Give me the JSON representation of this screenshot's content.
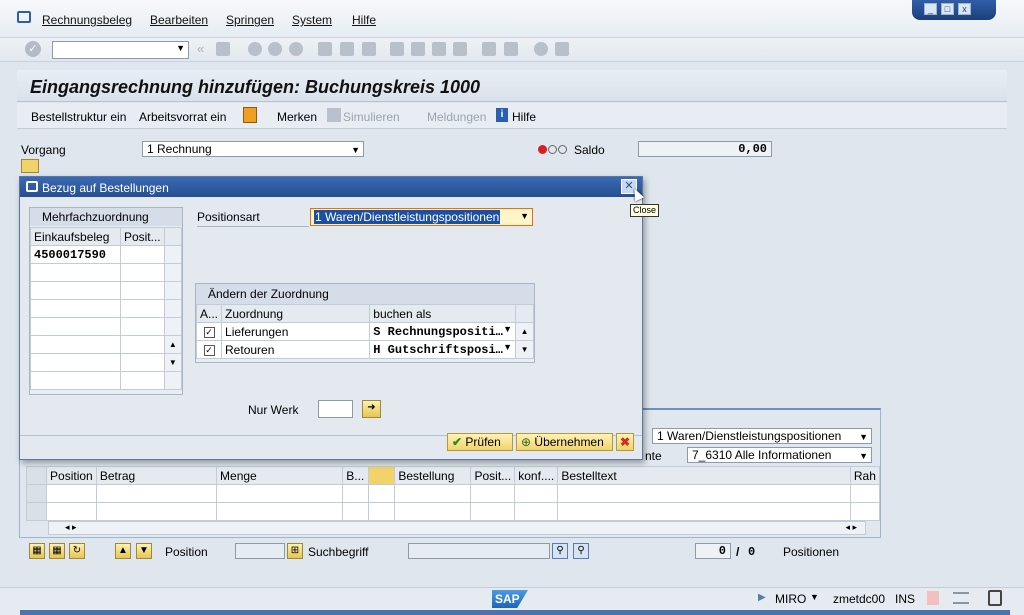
{
  "menu": {
    "items": [
      "Rechnungsbeleg",
      "Bearbeiten",
      "Springen",
      "System",
      "Hilfe"
    ]
  },
  "page": {
    "title": "Eingangsrechnung hinzufügen: Buchungskreis 1000"
  },
  "app_toolbar": {
    "bestellstruktur": "Bestellstruktur ein",
    "arbeitsvorrat": "Arbeitsvorrat ein",
    "merken": "Merken",
    "simulieren": "Simulieren",
    "meldungen": "Meldungen",
    "hilfe": "Hilfe"
  },
  "header": {
    "vorgang_label": "Vorgang",
    "vorgang_value": "1 Rechnung",
    "saldo_label": "Saldo",
    "saldo_value": "0,00"
  },
  "dialog": {
    "title": "Bezug auf Bestellungen",
    "close_tooltip": "Close",
    "mehrfach": {
      "title": "Mehrfachzuordnung",
      "columns": [
        "Einkaufsbeleg",
        "Posit..."
      ],
      "rows": [
        [
          "4500017590",
          ""
        ],
        [
          "",
          ""
        ],
        [
          "",
          ""
        ],
        [
          "",
          ""
        ],
        [
          "",
          ""
        ],
        [
          "",
          ""
        ],
        [
          "",
          ""
        ],
        [
          "",
          ""
        ]
      ]
    },
    "positionsart_label": "Positionsart",
    "positionsart_value": "1 Waren/Dienstleistungspositionen",
    "aenderung": {
      "title": "Ändern der Zuordnung",
      "columns": [
        "A...",
        "Zuordnung",
        "buchen als"
      ],
      "rows": [
        {
          "zuordnung": "Lieferungen",
          "buchen_als": "S Rechnungspositi…",
          "checked": true
        },
        {
          "zuordnung": "Retouren",
          "buchen_als": "H Gutschriftsposi…",
          "checked": true
        }
      ]
    },
    "nur_werk_label": "Nur Werk",
    "nur_werk_value": "",
    "pruefen": "Prüfen",
    "uebernehmen": "Übernehmen"
  },
  "lower": {
    "positionsart_value": "1 Waren/Dienstleistungspositionen",
    "layout_label_partial": "nte",
    "layout_value": "7_6310 Alle Informationen",
    "columns": [
      "Position",
      "Betrag",
      "Menge",
      "B...",
      "",
      "Bestellung",
      "Posit...",
      "konf....",
      "Bestelltext",
      "Rah"
    ],
    "position_label": "Position",
    "suchbegriff_label": "Suchbegriff",
    "count_current": "0",
    "count_sep": "/",
    "count_total": "0",
    "positionen_label": "Positionen"
  },
  "status": {
    "sap_logo": "SAP",
    "transaction": "MIRO",
    "server": "zmetdc00",
    "mode": "INS"
  },
  "colors": {
    "title_bar": "#24508f",
    "button_yellow": "#f2d36c",
    "selection_blue": "#1c4fa0"
  }
}
